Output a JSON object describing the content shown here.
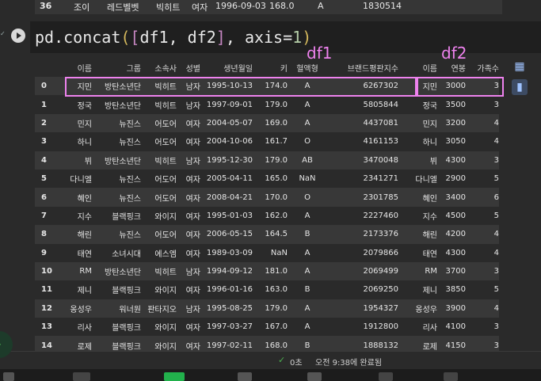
{
  "prev_row": {
    "idx": "36",
    "name": "조이",
    "group": "레드벨벳",
    "agency": "빅히트",
    "gender": "여자",
    "birth": "1996-09-03",
    "height": "168.0",
    "blood": "A",
    "brand": "1830514"
  },
  "code": {
    "fn": "pd.concat",
    "open_paren": "(",
    "open_br": "[",
    "args": "df1, df2",
    "close_br": "]",
    "comma": ", ",
    "kw": "axis=",
    "num": "1",
    "close_paren": ")"
  },
  "labels": {
    "df1": "df1",
    "df2": "df2"
  },
  "headers": [
    "",
    "이름",
    "그룹",
    "소속사",
    "성별",
    "생년월일",
    "키",
    "혈액형",
    "브랜드평판지수",
    "이름",
    "연봉",
    "가족수"
  ],
  "rows": [
    [
      "0",
      "지민",
      "방탄소년단",
      "빅히트",
      "남자",
      "1995-10-13",
      "174.0",
      "A",
      "6267302",
      "지민",
      "3000",
      "3"
    ],
    [
      "1",
      "정국",
      "방탄소년단",
      "빅히트",
      "남자",
      "1997-09-01",
      "179.0",
      "A",
      "5805844",
      "정국",
      "3500",
      "3"
    ],
    [
      "2",
      "민지",
      "뉴진스",
      "어도어",
      "여자",
      "2004-05-07",
      "169.0",
      "A",
      "4437081",
      "민지",
      "3200",
      "4"
    ],
    [
      "3",
      "하니",
      "뉴진스",
      "어도어",
      "여자",
      "2004-10-06",
      "161.7",
      "O",
      "4161153",
      "하니",
      "3050",
      "4"
    ],
    [
      "4",
      "뷔",
      "방탄소년단",
      "빅히트",
      "남자",
      "1995-12-30",
      "179.0",
      "AB",
      "3470048",
      "뷔",
      "4300",
      "3"
    ],
    [
      "5",
      "다니엘",
      "뉴진스",
      "어도어",
      "여자",
      "2005-04-11",
      "165.0",
      "NaN",
      "2341271",
      "다니엘",
      "2900",
      "5"
    ],
    [
      "6",
      "혜인",
      "뉴진스",
      "어도어",
      "여자",
      "2008-04-21",
      "170.0",
      "O",
      "2301785",
      "혜인",
      "3400",
      "6"
    ],
    [
      "7",
      "지수",
      "블랙핑크",
      "와이지",
      "여자",
      "1995-01-03",
      "162.0",
      "A",
      "2227460",
      "지수",
      "4500",
      "5"
    ],
    [
      "8",
      "해린",
      "뉴진스",
      "어도어",
      "여자",
      "2006-05-15",
      "164.5",
      "B",
      "2173376",
      "해린",
      "4200",
      "4"
    ],
    [
      "9",
      "태연",
      "소녀시대",
      "에스엠",
      "여자",
      "1989-03-09",
      "NaN",
      "A",
      "2079866",
      "태연",
      "4300",
      "4"
    ],
    [
      "10",
      "RM",
      "방탄소년단",
      "빅히트",
      "남자",
      "1994-09-12",
      "181.0",
      "A",
      "2069499",
      "RM",
      "3700",
      "3"
    ],
    [
      "11",
      "제니",
      "블랙핑크",
      "와이지",
      "여자",
      "1996-01-16",
      "163.0",
      "B",
      "2069250",
      "제니",
      "3850",
      "5"
    ],
    [
      "12",
      "옹성우",
      "워너원",
      "판타지오",
      "남자",
      "1995-08-25",
      "179.0",
      "A",
      "1954327",
      "옹성우",
      "3900",
      "4"
    ],
    [
      "13",
      "리사",
      "블랙핑크",
      "와이지",
      "여자",
      "1997-03-27",
      "167.0",
      "A",
      "1912800",
      "리사",
      "4100",
      "3"
    ],
    [
      "14",
      "로제",
      "블랙핑크",
      "와이지",
      "여자",
      "1997-02-11",
      "168.0",
      "B",
      "1888132",
      "로제",
      "4150",
      "3"
    ]
  ],
  "status": {
    "seconds": "0초",
    "completed": "오전 9:38에 완료됨"
  },
  "icons": {
    "run": "play-icon",
    "table": "table-icon",
    "chart": "chart-icon",
    "check": "check-icon"
  },
  "colors": {
    "highlight": "#ee82ee",
    "bg": "#2a2a2a",
    "row_alt": "#383838"
  }
}
